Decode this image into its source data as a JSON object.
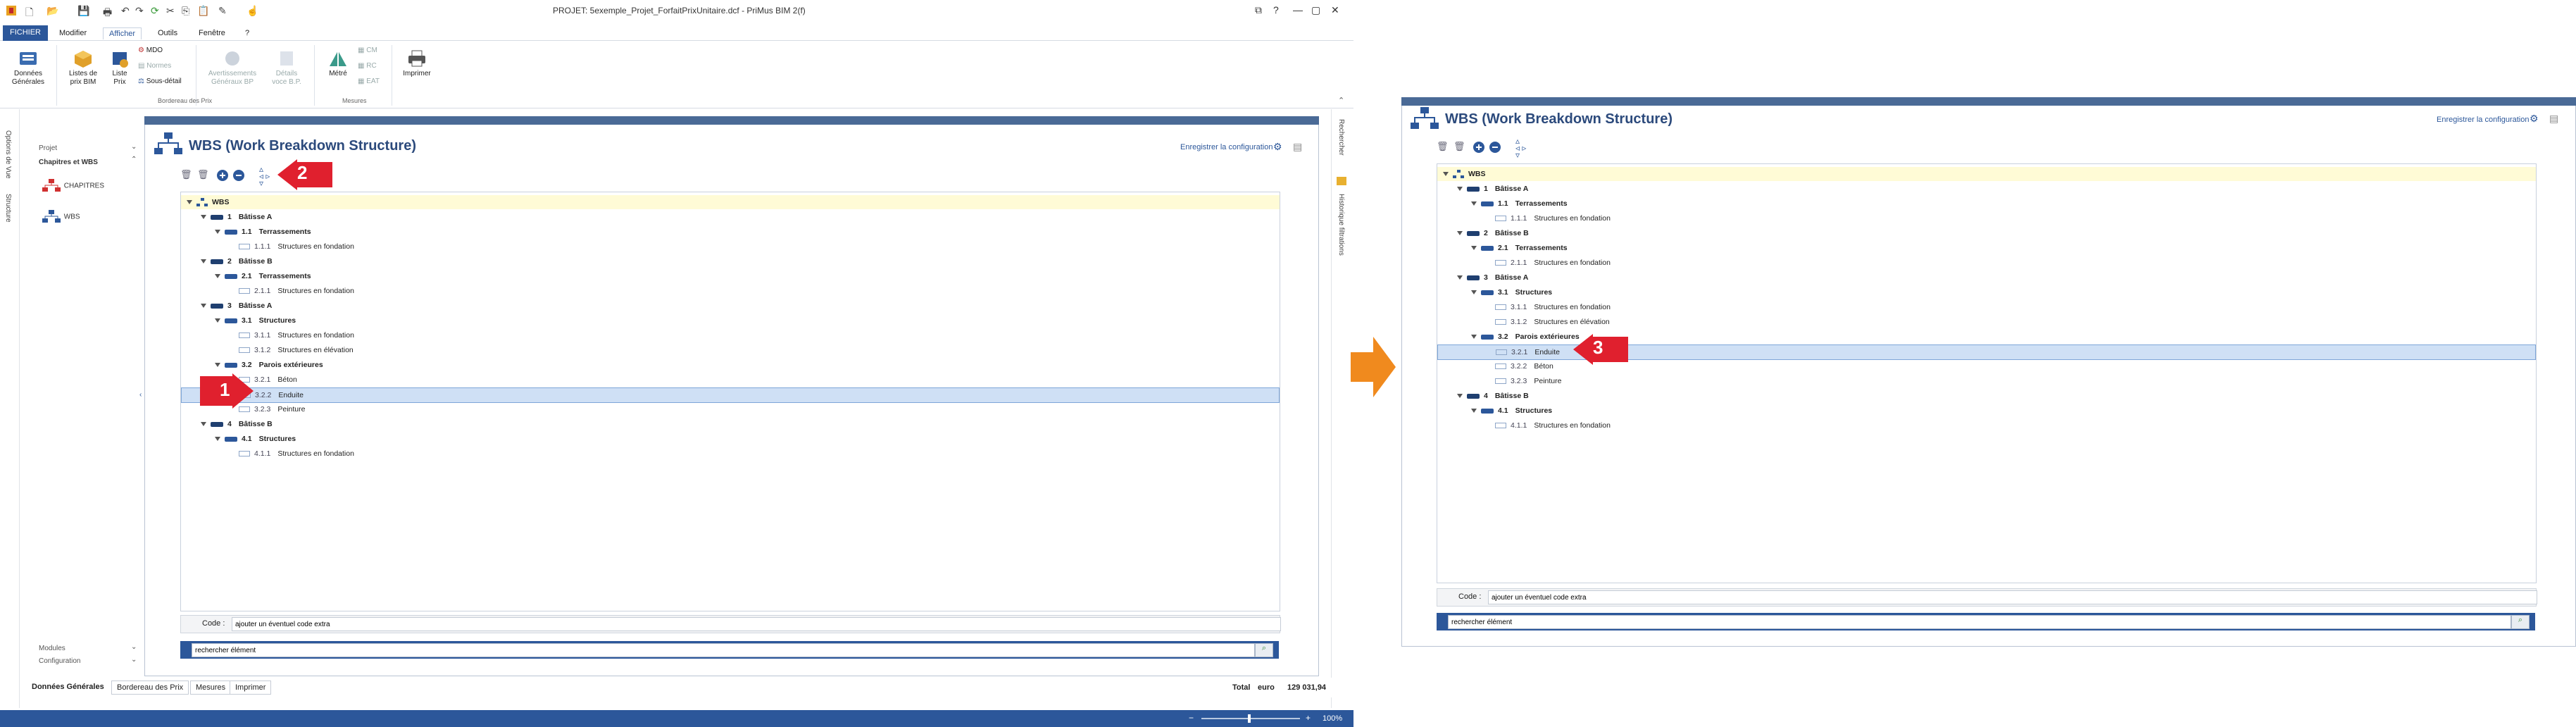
{
  "app": {
    "title": "PROJET: 5exemple_Projet_ForfaitPrixUnitaire.dcf - PriMus   BIM 2(f)"
  },
  "menu": {
    "items": [
      "FICHIER",
      "Modifier",
      "Afficher",
      "Outils",
      "Fenêtre",
      "?"
    ]
  },
  "ribbon": {
    "buttons": [
      {
        "label": "Données\nGénérales",
        "icon": "data-icon"
      },
      {
        "label": "Listes de\nprix BIM",
        "icon": "bim-list-icon"
      },
      {
        "label": "Liste\nPrix",
        "icon": "price-list-icon"
      },
      {
        "label": "MDO",
        "icon": "mdo-icon"
      },
      {
        "label": "Normes",
        "icon": "norms-icon"
      },
      {
        "label": "Sous-détail",
        "icon": "subdetail-icon"
      },
      {
        "label": "Avertissements\nGénéraux BP",
        "icon": "warnings-icon"
      },
      {
        "label": "Détails\nvoce B.P.",
        "icon": "details-icon"
      },
      {
        "label": "Métré",
        "icon": "metre-icon"
      },
      {
        "label": "CM",
        "icon": "cm-icon"
      },
      {
        "label": "RC",
        "icon": "rc-icon"
      },
      {
        "label": "EAT",
        "icon": "eat-icon"
      },
      {
        "label": "Imprimer",
        "icon": "print-icon"
      }
    ],
    "groups": [
      "Bordereau des Prix",
      "Mesures"
    ]
  },
  "left_strip": {
    "tabs": [
      "Options de Vue",
      "Structure"
    ]
  },
  "left_nav": {
    "projet": "Projet",
    "chapitres": "Chapitres et WBS",
    "items": [
      "CHAPITRES",
      "WBS"
    ],
    "modules": "Modules",
    "configuration": "Configuration"
  },
  "right_strip": {
    "tabs": [
      "Rechercher",
      "Historique filtrations"
    ]
  },
  "panel": {
    "title": "WBS (Work Breakdown Structure)",
    "save_config": "Enregistrer la configuration",
    "code_label": "Code :",
    "code_value": "ajouter un éventuel code extra",
    "search_value": "rechercher élément"
  },
  "tree_left": [
    {
      "code": "WBS",
      "label": "",
      "level": 0,
      "type": "root"
    },
    {
      "code": "1",
      "label": "Bâtisse A",
      "level": 1,
      "type": "group"
    },
    {
      "code": "1.1",
      "label": "Terrassements",
      "level": 2,
      "type": "group"
    },
    {
      "code": "1.1.1",
      "label": "Structures en fondation",
      "level": 3,
      "type": "leaf"
    },
    {
      "code": "2",
      "label": "Bâtisse B",
      "level": 1,
      "type": "group"
    },
    {
      "code": "2.1",
      "label": "Terrassements",
      "level": 2,
      "type": "group"
    },
    {
      "code": "2.1.1",
      "label": "Structures en fondation",
      "level": 3,
      "type": "leaf"
    },
    {
      "code": "3",
      "label": "Bâtisse A",
      "level": 1,
      "type": "group"
    },
    {
      "code": "3.1",
      "label": "Structures",
      "level": 2,
      "type": "group"
    },
    {
      "code": "3.1.1",
      "label": "Structures en fondation",
      "level": 3,
      "type": "leaf"
    },
    {
      "code": "3.1.2",
      "label": "Structures en élévation",
      "level": 3,
      "type": "leaf"
    },
    {
      "code": "3.2",
      "label": "Parois extérieures",
      "level": 2,
      "type": "group"
    },
    {
      "code": "3.2.1",
      "label": "Béton",
      "level": 3,
      "type": "leaf"
    },
    {
      "code": "3.2.2",
      "label": "Enduite",
      "level": 3,
      "type": "leaf",
      "selected": true
    },
    {
      "code": "3.2.3",
      "label": "Peinture",
      "level": 3,
      "type": "leaf"
    },
    {
      "code": "4",
      "label": "Bâtisse B",
      "level": 1,
      "type": "group"
    },
    {
      "code": "4.1",
      "label": "Structures",
      "level": 2,
      "type": "group"
    },
    {
      "code": "4.1.1",
      "label": "Structures en fondation",
      "level": 3,
      "type": "leaf"
    }
  ],
  "tree_right": [
    {
      "code": "WBS",
      "label": "",
      "level": 0,
      "type": "root"
    },
    {
      "code": "1",
      "label": "Bâtisse A",
      "level": 1,
      "type": "group"
    },
    {
      "code": "1.1",
      "label": "Terrassements",
      "level": 2,
      "type": "group"
    },
    {
      "code": "1.1.1",
      "label": "Structures en fondation",
      "level": 3,
      "type": "leaf"
    },
    {
      "code": "2",
      "label": "Bâtisse B",
      "level": 1,
      "type": "group"
    },
    {
      "code": "2.1",
      "label": "Terrassements",
      "level": 2,
      "type": "group"
    },
    {
      "code": "2.1.1",
      "label": "Structures en fondation",
      "level": 3,
      "type": "leaf"
    },
    {
      "code": "3",
      "label": "Bâtisse A",
      "level": 1,
      "type": "group"
    },
    {
      "code": "3.1",
      "label": "Structures",
      "level": 2,
      "type": "group"
    },
    {
      "code": "3.1.1",
      "label": "Structures en fondation",
      "level": 3,
      "type": "leaf"
    },
    {
      "code": "3.1.2",
      "label": "Structures en élévation",
      "level": 3,
      "type": "leaf"
    },
    {
      "code": "3.2",
      "label": "Parois extérieures",
      "level": 2,
      "type": "group"
    },
    {
      "code": "3.2.1",
      "label": "Enduite",
      "level": 3,
      "type": "leaf",
      "selected": true
    },
    {
      "code": "3.2.2",
      "label": "Béton",
      "level": 3,
      "type": "leaf"
    },
    {
      "code": "3.2.3",
      "label": "Peinture",
      "level": 3,
      "type": "leaf"
    },
    {
      "code": "4",
      "label": "Bâtisse B",
      "level": 1,
      "type": "group"
    },
    {
      "code": "4.1",
      "label": "Structures",
      "level": 2,
      "type": "group"
    },
    {
      "code": "4.1.1",
      "label": "Structures en fondation",
      "level": 3,
      "type": "leaf"
    }
  ],
  "bottom_tabs": [
    "Données Générales",
    "Bordereau des Prix",
    "Mesures",
    "Imprimer"
  ],
  "totals": {
    "label": "Total",
    "currency": "euro",
    "value": "129 031,94"
  },
  "status": {
    "zoom": "100%"
  },
  "callouts": [
    "1",
    "2",
    "3"
  ],
  "colors": {
    "accent": "#2c579a",
    "arrow": "#e0202e",
    "orange_arrow": "#f08a1e",
    "selection": "#cfe0f5",
    "root_row": "#fffbd6"
  }
}
